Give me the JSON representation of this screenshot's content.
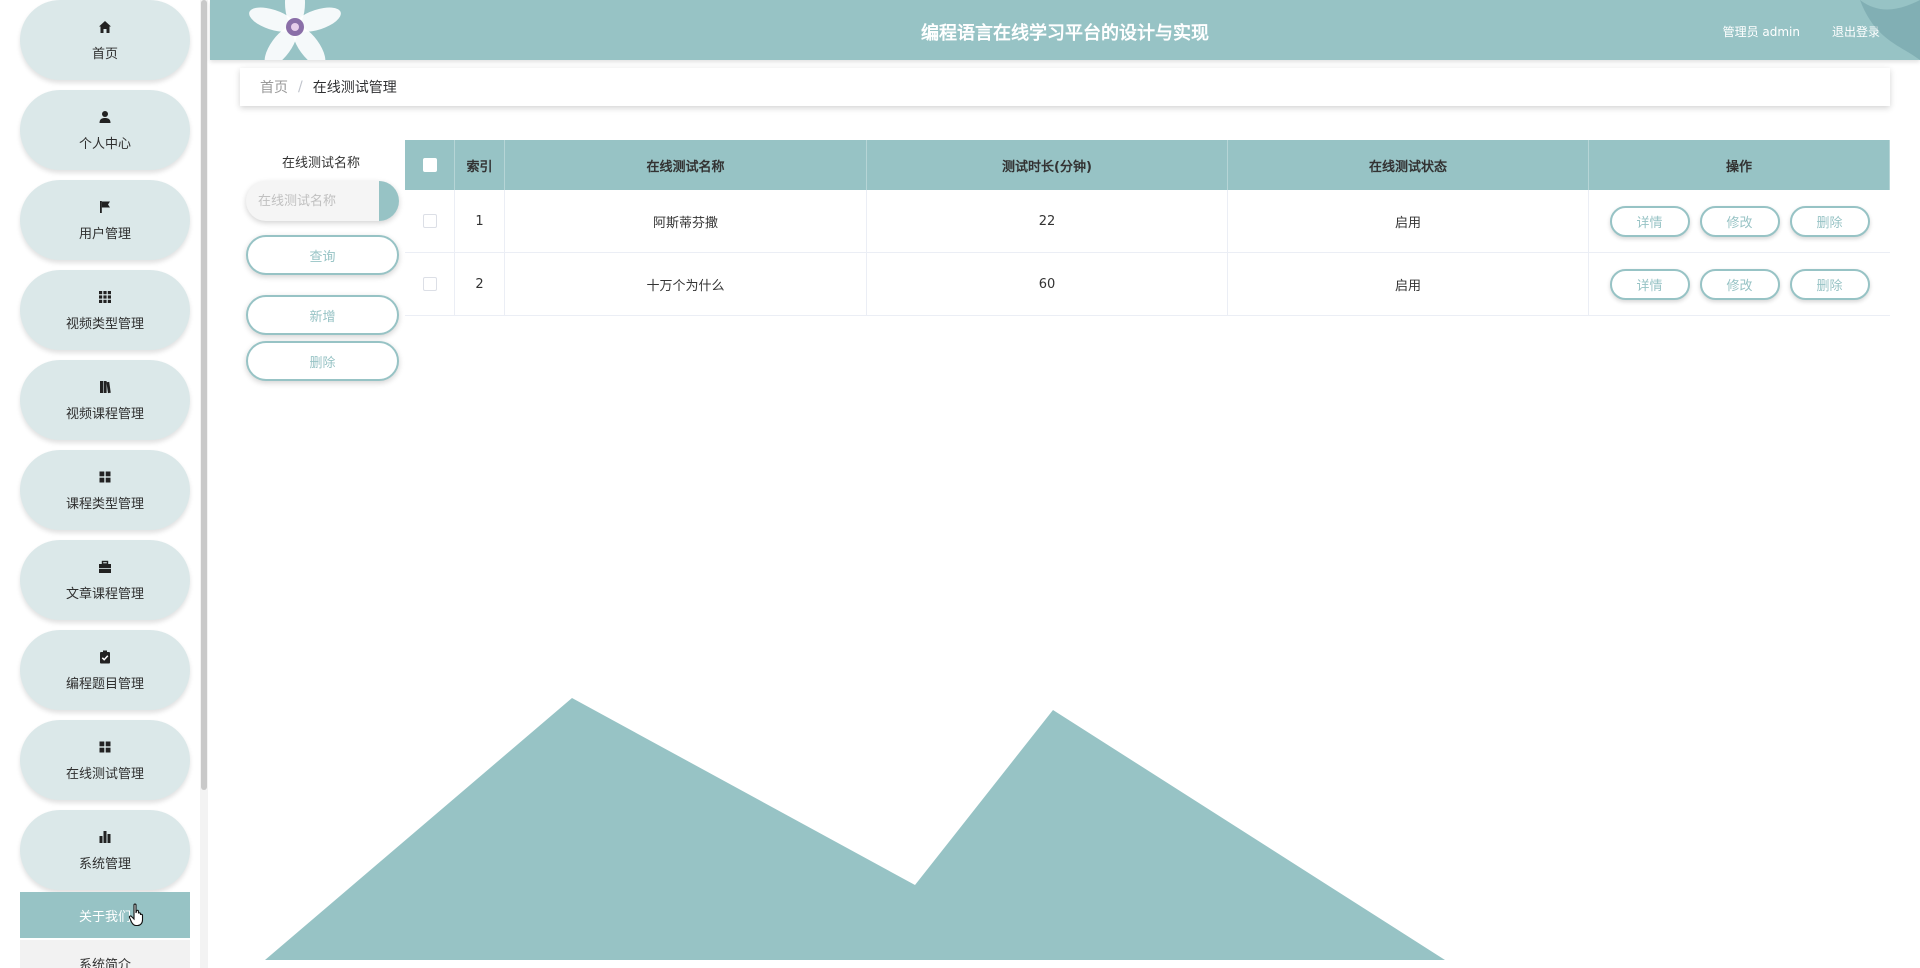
{
  "app": {
    "title": "编程语言在线学习平台的设计与实现",
    "user": "管理员 admin",
    "logout": "退出登录",
    "accent_color": "#97c3c5"
  },
  "sidebar": {
    "items": [
      {
        "label": "首页",
        "icon": "home-icon"
      },
      {
        "label": "个人中心",
        "icon": "user-icon"
      },
      {
        "label": "用户管理",
        "icon": "flag-icon"
      },
      {
        "label": "视频类型管理",
        "icon": "grid-icon"
      },
      {
        "label": "视频课程管理",
        "icon": "book-icon"
      },
      {
        "label": "课程类型管理",
        "icon": "apps-icon"
      },
      {
        "label": "文章课程管理",
        "icon": "briefcase-icon"
      },
      {
        "label": "编程题目管理",
        "icon": "clipboard-icon"
      },
      {
        "label": "在线测试管理",
        "icon": "apps-icon"
      },
      {
        "label": "系统管理",
        "icon": "bar-chart-icon"
      }
    ],
    "submenu": [
      {
        "label": "关于我们",
        "active": true
      },
      {
        "label": "系统简介",
        "active": false
      }
    ]
  },
  "breadcrumb": {
    "home": "首页",
    "separator": "/",
    "current": "在线测试管理"
  },
  "search": {
    "label": "在线测试名称",
    "placeholder": "在线测试名称",
    "query_button": "查询",
    "add_button": "新增",
    "delete_button": "删除"
  },
  "table": {
    "columns": [
      "索引",
      "在线测试名称",
      "测试时长(分钟)",
      "在线测试状态",
      "操作"
    ],
    "rows": [
      {
        "index": "1",
        "name": "阿斯蒂芬撒",
        "duration": "22",
        "status": "启用"
      },
      {
        "index": "2",
        "name": "十万个为什么",
        "duration": "60",
        "status": "启用"
      }
    ],
    "actions": {
      "detail": "详情",
      "edit": "修改",
      "delete": "删除"
    }
  }
}
